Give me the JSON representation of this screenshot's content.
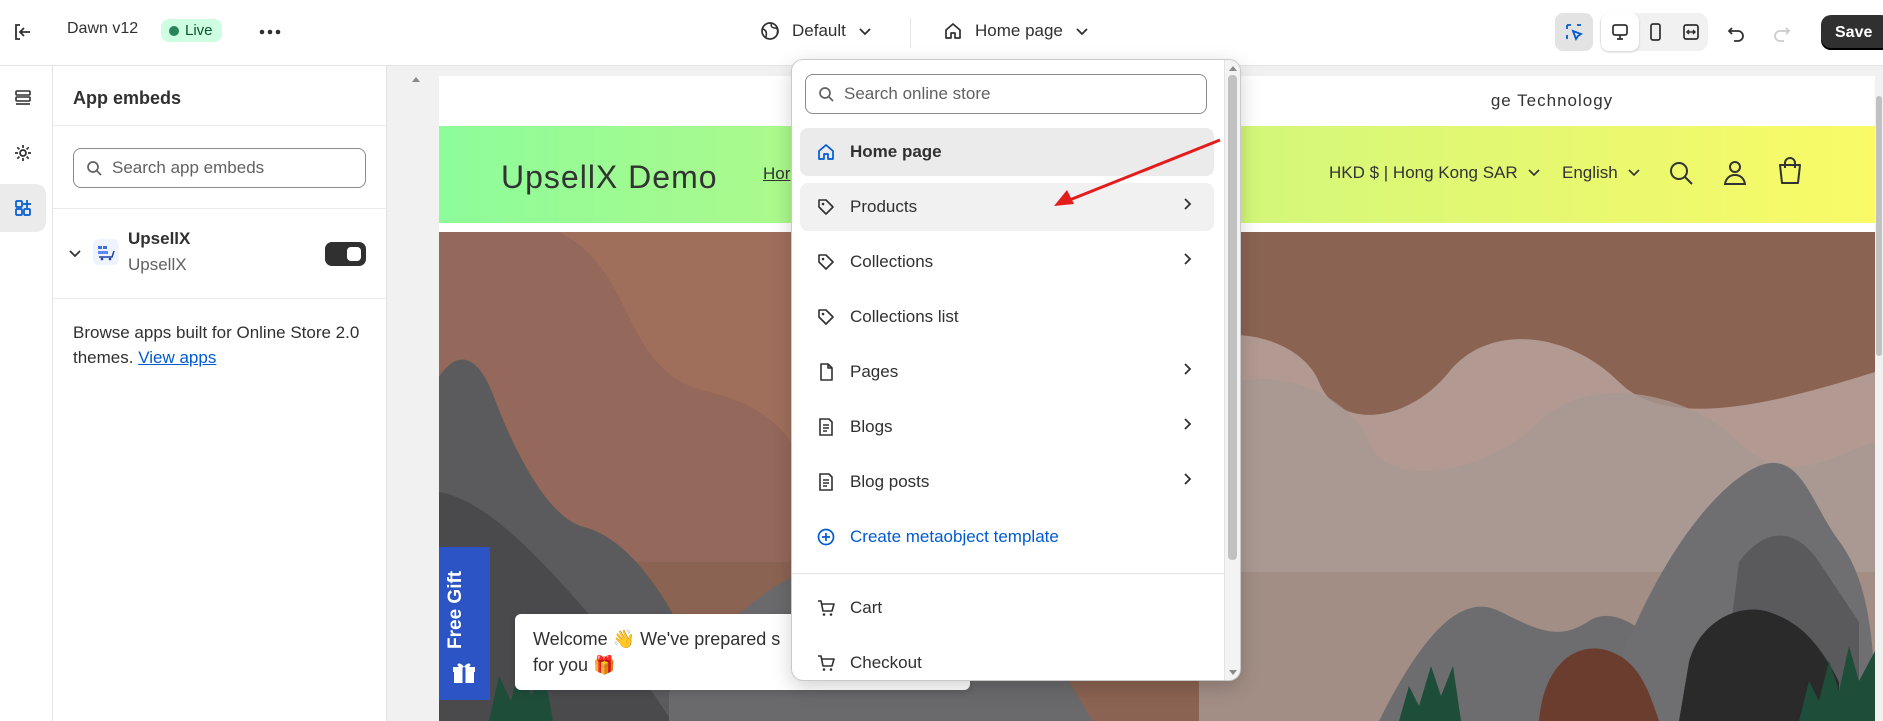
{
  "topbar": {
    "theme_name": "Dawn v12",
    "live_label": "Live",
    "theme_selector": "Default",
    "page_selector": "Home page",
    "save_label": "Save"
  },
  "rail": {
    "items": [
      "sections-icon",
      "settings-icon",
      "app-embeds-icon"
    ]
  },
  "panel": {
    "title": "App embeds",
    "search_placeholder": "Search app embeds",
    "embed": {
      "name": "UpsellX",
      "provider": "UpsellX",
      "enabled": true
    },
    "browse_text": "Browse apps built for Online Store 2.0 themes.",
    "view_apps_link": "View apps"
  },
  "store": {
    "announcement": "ge Technology",
    "brand": "UpsellX Demo",
    "nav_partial": "Hor",
    "currency": "HKD $ | Hong Kong SAR",
    "language": "English",
    "free_gift": "Free Gift",
    "popup_line1": "Welcome 👋 We've prepared s",
    "popup_line2": "for you 🎁"
  },
  "dropdown": {
    "search_placeholder": "Search online store",
    "items": [
      {
        "label": "Home page",
        "icon": "home-icon",
        "chevron": false
      },
      {
        "label": "Products",
        "icon": "tag-icon",
        "chevron": true
      },
      {
        "label": "Collections",
        "icon": "tag-icon",
        "chevron": true
      },
      {
        "label": "Collections list",
        "icon": "tag-icon",
        "chevron": false
      },
      {
        "label": "Pages",
        "icon": "page-icon",
        "chevron": true
      },
      {
        "label": "Blogs",
        "icon": "blog-icon",
        "chevron": true
      },
      {
        "label": "Blog posts",
        "icon": "blog-icon",
        "chevron": true
      },
      {
        "label": "Create metaobject template",
        "icon": "plus-circle-icon",
        "chevron": false
      },
      {
        "label": "Cart",
        "icon": "cart-icon",
        "chevron": false
      },
      {
        "label": "Checkout",
        "icon": "cart-icon",
        "chevron": false
      }
    ]
  },
  "colors": {
    "accent_link": "#005bd3",
    "live_bg": "#cdfee1",
    "save_bg": "#303030",
    "annotation_arrow": "#e51c1c"
  }
}
